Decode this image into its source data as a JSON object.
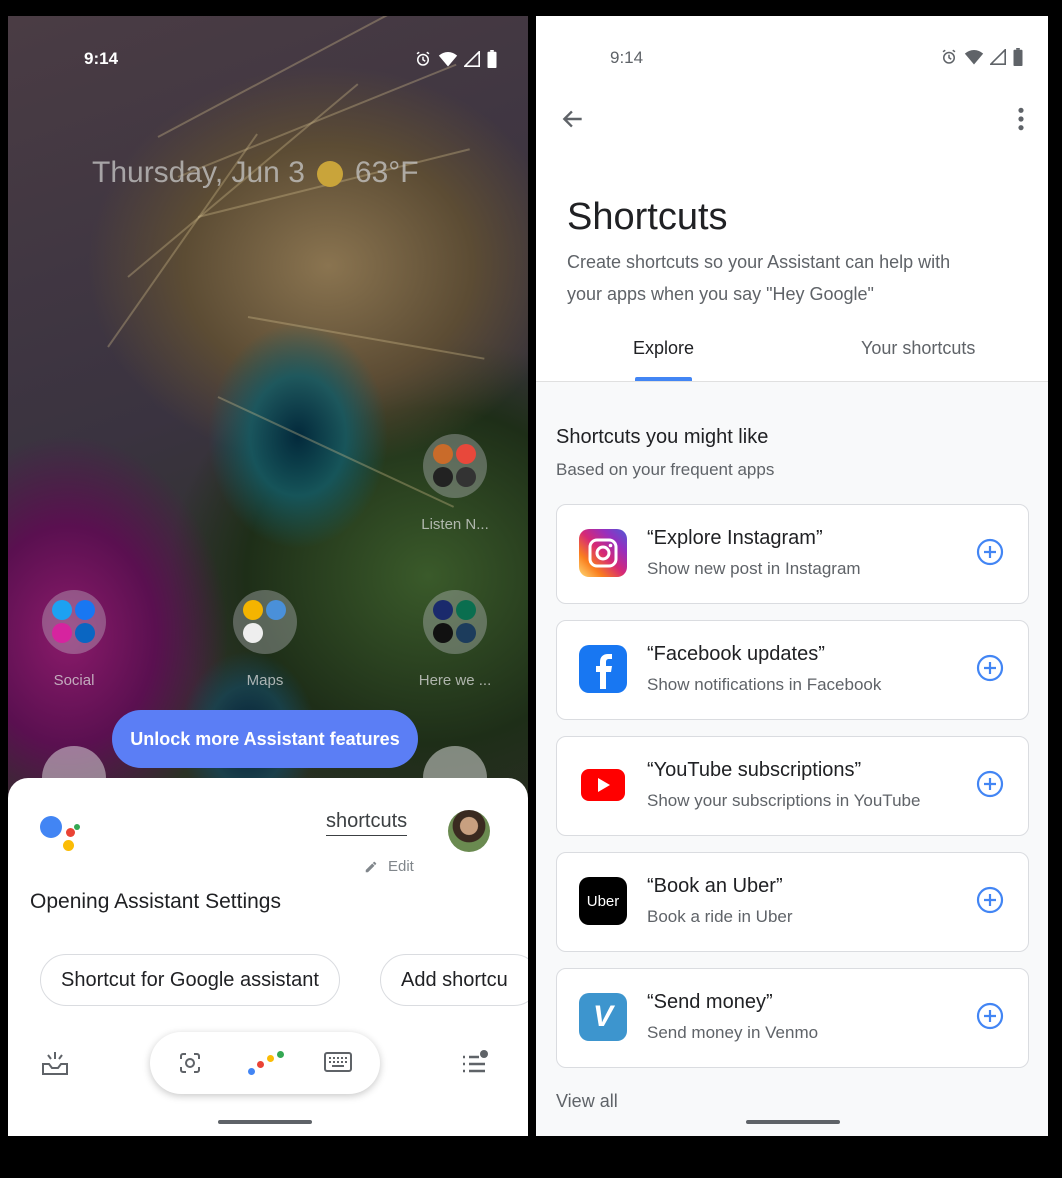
{
  "left": {
    "status_time": "9:14",
    "date_line": "Thursday, Jun 3",
    "temperature": "63°F",
    "folders": [
      {
        "label": "Listen N..."
      },
      {
        "label": "Social"
      },
      {
        "label": "Maps"
      },
      {
        "label": "Here we ..."
      }
    ],
    "unlock_button": "Unlock more Assistant features",
    "assistant": {
      "query": "shortcuts",
      "edit_label": "Edit",
      "response": "Opening Assistant Settings",
      "chips": [
        "Shortcut for Google assistant",
        "Add shortcu"
      ]
    }
  },
  "right": {
    "status_time": "9:14",
    "title": "Shortcuts",
    "subtitle": "Create shortcuts so your Assistant can help with your apps when you say \"Hey Google\"",
    "tabs": [
      "Explore",
      "Your shortcuts"
    ],
    "section_title": "Shortcuts you might like",
    "section_subtitle": "Based on your frequent apps",
    "cards": [
      {
        "title": "“Explore Instagram”",
        "desc": "Show new post in Instagram",
        "icon": "instagram-icon"
      },
      {
        "title": "“Facebook updates”",
        "desc": "Show notifications in Facebook",
        "icon": "facebook-icon"
      },
      {
        "title": "“YouTube subscriptions”",
        "desc": "Show your subscriptions in YouTube",
        "icon": "youtube-icon"
      },
      {
        "title": "“Book an Uber”",
        "desc": "Book a ride in Uber",
        "icon": "uber-icon",
        "icon_text": "Uber"
      },
      {
        "title": "“Send money”",
        "desc": "Send money in Venmo",
        "icon": "venmo-icon",
        "icon_text": "V"
      }
    ],
    "view_all": "View all"
  },
  "colors": {
    "accent_blue": "#4285f4",
    "unlock_button": "#5b7ef5",
    "google_blue": "#4285f4",
    "google_red": "#ea4335",
    "google_yellow": "#fbbc05",
    "google_green": "#34a853"
  }
}
